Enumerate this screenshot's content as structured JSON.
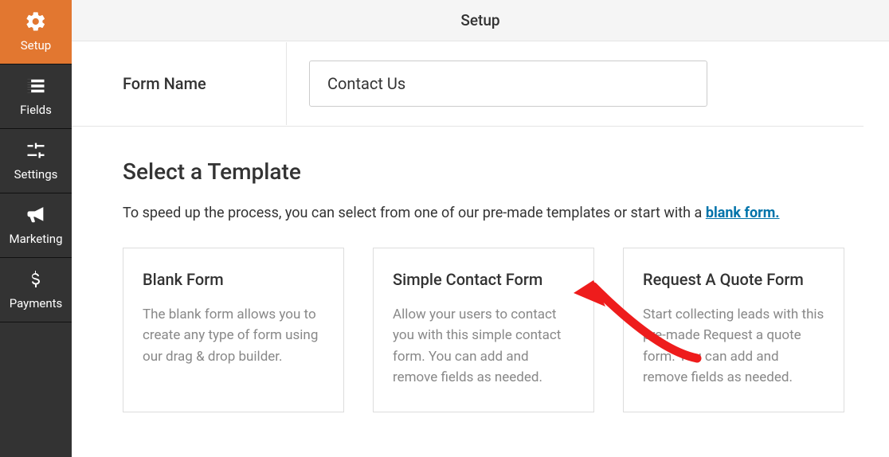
{
  "sidebar": {
    "items": [
      {
        "label": "Setup",
        "active": true
      },
      {
        "label": "Fields"
      },
      {
        "label": "Settings"
      },
      {
        "label": "Marketing"
      },
      {
        "label": "Payments"
      }
    ]
  },
  "topbar": {
    "title": "Setup"
  },
  "form_name": {
    "label": "Form Name",
    "value": "Contact Us"
  },
  "section": {
    "title": "Select a Template",
    "subtitle_prefix": "To speed up the process, you can select from one of our pre-made templates or start with a ",
    "subtitle_link": "blank form."
  },
  "templates": [
    {
      "title": "Blank Form",
      "description": "The blank form allows you to create any type of form using our drag & drop builder."
    },
    {
      "title": "Simple Contact Form",
      "description": "Allow your users to contact you with this simple contact form. You can add and remove fields as needed."
    },
    {
      "title": "Request A Quote Form",
      "description": "Start collecting leads with this pre-made Request a quote form. You can add and remove fields as needed."
    }
  ]
}
